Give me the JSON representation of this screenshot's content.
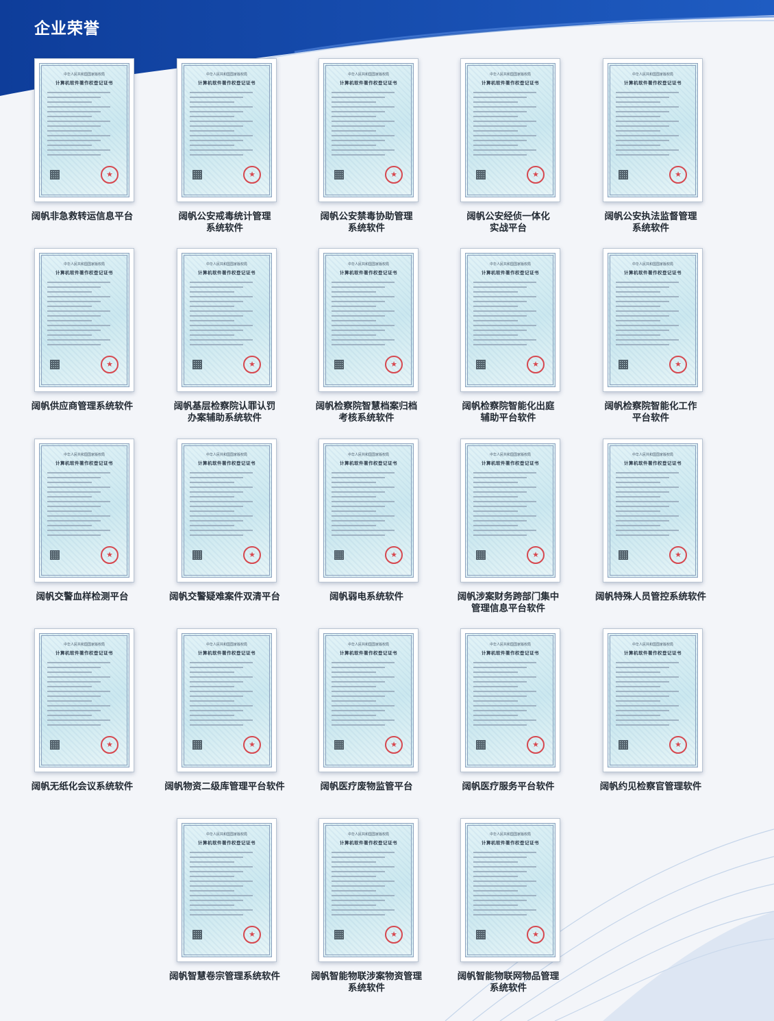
{
  "header": {
    "title": "企业荣誉"
  },
  "certificate_template": {
    "issuer": "中华人民共和国国家版权局",
    "title": "计算机软件著作权登记证书",
    "seal_icon": "star-icon"
  },
  "certificates": [
    {
      "caption": "阔帆非急救转运信息平台"
    },
    {
      "caption": "阔帆公安戒毒统计管理\n系统软件"
    },
    {
      "caption": "阔帆公安禁毒协助管理\n系统软件"
    },
    {
      "caption": "阔帆公安经侦一体化\n实战平台"
    },
    {
      "caption": "阔帆公安执法监督管理\n系统软件"
    },
    {
      "caption": "阔帆供应商管理系统软件"
    },
    {
      "caption": "阔帆基层检察院认罪认罚\n办案辅助系统软件"
    },
    {
      "caption": "阔帆检察院智慧档案归档\n考核系统软件"
    },
    {
      "caption": "阔帆检察院智能化出庭\n辅助平台软件"
    },
    {
      "caption": "阔帆检察院智能化工作\n平台软件"
    },
    {
      "caption": "阔帆交警血样检测平台"
    },
    {
      "caption": "阔帆交警疑难案件双清平台"
    },
    {
      "caption": "阔帆弱电系统软件"
    },
    {
      "caption": "阔帆涉案财务跨部门集中\n管理信息平台软件"
    },
    {
      "caption": "阔帆特殊人员管控系统软件"
    },
    {
      "caption": "阔帆无纸化会议系统软件"
    },
    {
      "caption": "阔帆物资二级库管理平台软件"
    },
    {
      "caption": "阔帆医疗废物监管平台"
    },
    {
      "caption": "阔帆医疗服务平台软件"
    },
    {
      "caption": "阔帆约见检察官管理软件"
    },
    {
      "caption": "阔帆智慧卷宗管理系统软件"
    },
    {
      "caption": "阔帆智能物联涉案物资管理\n系统软件"
    },
    {
      "caption": "阔帆智能物联网物品管理\n系统软件"
    }
  ],
  "colors": {
    "header_blue": "#1848a8",
    "seal_red": "#d6474e",
    "caption": "#222a33"
  }
}
